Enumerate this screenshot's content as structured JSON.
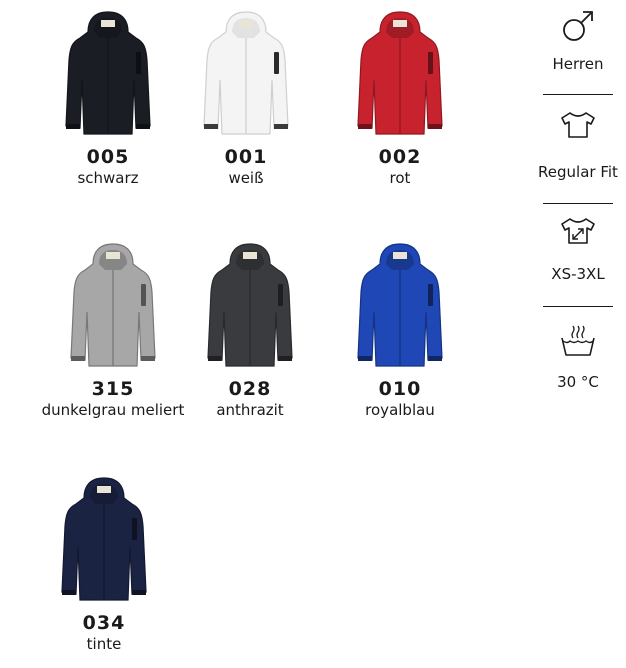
{
  "colors": [
    {
      "code": "005",
      "name": "schwarz",
      "hex": "#1b1d24"
    },
    {
      "code": "001",
      "name": "weiß",
      "hex": "#f4f4f4"
    },
    {
      "code": "002",
      "name": "rot",
      "hex": "#c8222f"
    },
    {
      "code": "315",
      "name": "dunkelgrau meliert",
      "hex": "#a7a7a7"
    },
    {
      "code": "028",
      "name": "anthrazit",
      "hex": "#3a3b3e"
    },
    {
      "code": "010",
      "name": "royalblau",
      "hex": "#1f47b5"
    },
    {
      "code": "034",
      "name": "tinte",
      "hex": "#1b2342"
    }
  ],
  "features": {
    "gender": {
      "label": "Herren",
      "icon": "male-icon"
    },
    "fit": {
      "label": "Regular Fit",
      "icon": "tshirt-icon"
    },
    "sizes": {
      "label": "XS-3XL",
      "icon": "size-arrows-icon"
    },
    "wash": {
      "label": "30 °C",
      "icon": "wash-tub-icon"
    }
  }
}
